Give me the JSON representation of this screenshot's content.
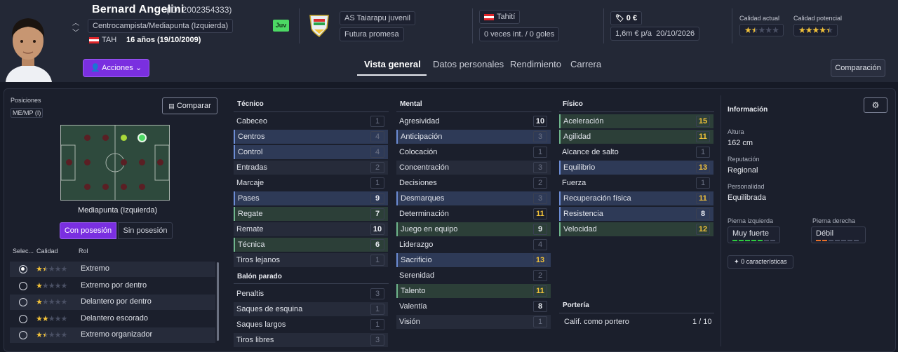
{
  "player": {
    "name": "Bernard Angelini",
    "id_text": "(ID: 2002354333)",
    "position": "Centrocampista/Mediapunta (Izquierda)",
    "nation_code": "TAH",
    "age_text": "16 años (19/10/2009)",
    "youth_badge": "Juv",
    "club": "AS Taiarapu juvenil",
    "club_status": "Futura promesa",
    "nationality": "Tahití",
    "caps": "0 veces int. / 0 goles",
    "value": "0 €",
    "wage": "1,6m € p/a",
    "contract_end": "20/10/2026",
    "current_ability_label": "Calidad actual",
    "potential_ability_label": "Calidad potencial",
    "current_ability_stars": 1.5,
    "potential_ability_stars": 4.5
  },
  "actions_label": "Acciones",
  "tabs": [
    {
      "label": "Vista general",
      "active": true
    },
    {
      "label": "Datos personales",
      "active": false
    },
    {
      "label": "Rendimiento",
      "active": false
    },
    {
      "label": "Carrera",
      "active": false
    }
  ],
  "comparison_label": "Comparación",
  "positions": {
    "title": "Posiciones",
    "badge": "ME/MP (I)",
    "compare_label": "Comparar",
    "current_label": "Mediapunta (Izquierda)",
    "with_ball": "Con posesión",
    "without_ball": "Sin posesión"
  },
  "roles": {
    "headers": {
      "select": "Selec...",
      "quality": "Calidad",
      "role": "Rol"
    },
    "items": [
      {
        "name": "Extremo",
        "stars": 1.5,
        "selected": true
      },
      {
        "name": "Extremo por dentro",
        "stars": 1,
        "selected": false
      },
      {
        "name": "Delantero por dentro",
        "stars": 1,
        "selected": false
      },
      {
        "name": "Delantero escorado",
        "stars": 2,
        "selected": false
      },
      {
        "name": "Extremo organizador",
        "stars": 1.5,
        "selected": false
      }
    ]
  },
  "technical": {
    "title": "Técnico",
    "attributes": [
      {
        "name": "Cabeceo",
        "value": "1"
      },
      {
        "name": "Centros",
        "value": "4"
      },
      {
        "name": "Control",
        "value": "4"
      },
      {
        "name": "Entradas",
        "value": "2"
      },
      {
        "name": "Marcaje",
        "value": "1"
      },
      {
        "name": "Pases",
        "value": "9"
      },
      {
        "name": "Regate",
        "value": "7"
      },
      {
        "name": "Remate",
        "value": "10"
      },
      {
        "name": "Técnica",
        "value": "6"
      },
      {
        "name": "Tiros lejanos",
        "value": "1"
      }
    ]
  },
  "set_pieces": {
    "title": "Balón parado",
    "attributes": [
      {
        "name": "Penaltis",
        "value": "3"
      },
      {
        "name": "Saques de esquina",
        "value": "1"
      },
      {
        "name": "Saques largos",
        "value": "1"
      },
      {
        "name": "Tiros libres",
        "value": "3"
      }
    ]
  },
  "mental": {
    "title": "Mental",
    "attributes": [
      {
        "name": "Agresividad",
        "value": "10"
      },
      {
        "name": "Anticipación",
        "value": "3"
      },
      {
        "name": "Colocación",
        "value": "1"
      },
      {
        "name": "Concentración",
        "value": "3"
      },
      {
        "name": "Decisiones",
        "value": "2"
      },
      {
        "name": "Desmarques",
        "value": "3"
      },
      {
        "name": "Determinación",
        "value": "11"
      },
      {
        "name": "Juego en equipo",
        "value": "9"
      },
      {
        "name": "Liderazgo",
        "value": "4"
      },
      {
        "name": "Sacrificio",
        "value": "13"
      },
      {
        "name": "Serenidad",
        "value": "2"
      },
      {
        "name": "Talento",
        "value": "11"
      },
      {
        "name": "Valentía",
        "value": "8"
      },
      {
        "name": "Visión",
        "value": "1"
      }
    ]
  },
  "physical": {
    "title": "Físico",
    "attributes": [
      {
        "name": "Aceleración",
        "value": "15"
      },
      {
        "name": "Agilidad",
        "value": "11"
      },
      {
        "name": "Alcance de salto",
        "value": "1"
      },
      {
        "name": "Equilibrio",
        "value": "13"
      },
      {
        "name": "Fuerza",
        "value": "1"
      },
      {
        "name": "Recuperación física",
        "value": "11"
      },
      {
        "name": "Resistencia",
        "value": "8"
      },
      {
        "name": "Velocidad",
        "value": "12"
      }
    ]
  },
  "goalkeeping": {
    "title": "Portería",
    "label": "Calif. como portero",
    "value": "1 / 10"
  },
  "info": {
    "title": "Información",
    "height_label": "Altura",
    "height": "162 cm",
    "reputation_label": "Reputación",
    "reputation": "Regional",
    "personality_label": "Personalidad",
    "personality": "Equilibrada",
    "left_foot_label": "Pierna izquierda",
    "left_foot": "Muy fuerte",
    "left_foot_level": 5,
    "right_foot_label": "Pierna derecha",
    "right_foot": "Débil",
    "right_foot_level": 2,
    "traits": "0 características"
  },
  "colors": {
    "accent": "#7a2fe0",
    "star": "#f2c23a",
    "foot_strong": "#2ecc40",
    "foot_weak": "#e8702a"
  }
}
